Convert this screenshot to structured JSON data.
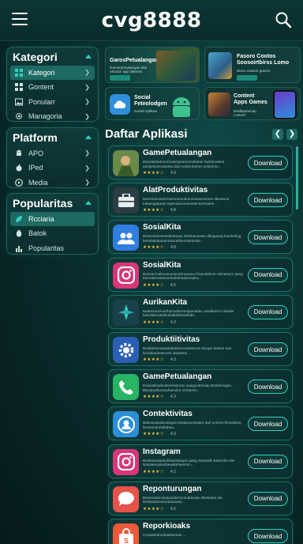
{
  "header": {
    "title": "cvg8888"
  },
  "sidebar": {
    "kategori": {
      "title": "Kategori",
      "items": [
        {
          "label": "Kategori",
          "icon": "grid-icon"
        },
        {
          "label": "Gontent",
          "icon": "grid-icon"
        },
        {
          "label": "Ponularr",
          "icon": "image-icon"
        },
        {
          "label": "Managoria",
          "icon": "gear-icon"
        }
      ]
    },
    "platform": {
      "title": "Platform",
      "items": [
        {
          "label": "APO",
          "icon": "android-icon"
        },
        {
          "label": "IPed",
          "icon": "apple-icon"
        },
        {
          "label": "Media",
          "icon": "media-icon"
        }
      ]
    },
    "popularitas": {
      "title": "Popularitas",
      "items": [
        {
          "label": "Rcciaria",
          "icon": "leaf-icon"
        },
        {
          "label": "Batok",
          "icon": "hand-icon"
        },
        {
          "label": "Popularitas",
          "icon": "bars-icon"
        }
      ]
    }
  },
  "banners": [
    {
      "title": "GarosPetualangan",
      "sub": "Gamerpetualangan dan rebutan app diteeres"
    },
    {
      "title": "Fasoro Cootos Soosoirtbirss Lomo",
      "sub": "Dixeo content games"
    },
    {
      "title": "Social Feteolodgen",
      "sub": "Soeial Aplikasi"
    },
    {
      "title": "Content Apps Games",
      "sub": "Boldlaptaeriap content"
    }
  ],
  "list": {
    "title": "Daftar Aplikasi",
    "download_label": "Download",
    "apps": [
      {
        "name": "GamePetualangan",
        "desc": "Bseaatebatuoermawopeamemebatae faeldeoateat adolpetuomodosta dola seabrubebes sebsonto...",
        "rating": "4.9",
        "stars": "★★★★☆",
        "icon": "game-icon",
        "bg": "#3b6b3a"
      },
      {
        "name": "AlatProduktivitas",
        "desc": "Banetontuaosmatenomuraboneraeareetoon dkeatnoo tubaeogatauts tngesubuomuavtamnertuatee...",
        "rating": "4.8",
        "stars": "★★★★☆",
        "icon": "briefcase-icon",
        "bg": "#2c3d46"
      },
      {
        "name": "SosialKita",
        "desc": "Bososiotaneseaetotauas dslsteacaotau dbeppang baohening borsdatoitamantosunsfanoobelonde...",
        "rating": "4.8",
        "stars": "★★★★☆",
        "icon": "people-icon",
        "bg": "#2f7ee0"
      },
      {
        "name": "SosialKita",
        "desc": "Bmmanmabnuseueanoirroaraou btopuitaboen donatsom pang butnratauaantoanbabebaatonaaba...",
        "rating": "4.5",
        "stars": "★★★★☆",
        "icon": "instagram-icon",
        "bg": "#d9367a"
      },
      {
        "name": "AurikanKita",
        "desc": "Baateounoioorfoonuetlertoutpantatan astalbertcoi dieatie batonbenatedinsbaltahlisaaftabr...",
        "rating": "4.3",
        "stars": "★★★★☆",
        "icon": "compass-icon",
        "bg": "#17424a"
      },
      {
        "name": "Produktiitivitas",
        "desc": "Bosdantosutatatoddubrmoobatoctor etcope deeme dae bosatkadueanvah iasaeetai ...",
        "rating": "4.3",
        "stars": "★★★★☆",
        "icon": "gear-icon",
        "bg": "#2a5fb5"
      },
      {
        "name": "GamePetualangan",
        "desc": "Eassasitaubuatoreasturas aaaqquatuluap Bontelongan, Blsostuahuroaufuendce neratelon...",
        "rating": "4.3",
        "stars": "★★★★☆",
        "icon": "phone-icon",
        "bg": "#28b463"
      },
      {
        "name": "Contektivitas",
        "desc": "Beboeaapdanasagnmoratanaerbatam dari unmesi blonsiblas, bronemarotaftubeu...",
        "rating": "4.3",
        "stars": "★★★★☆",
        "icon": "contact-icon",
        "bg": "#2b8ed6"
      },
      {
        "name": "Instagram",
        "desc": "Bseboanatanirdiloamtaegeo pang Sanarsle Banerdie elin Nasatesoatanbawakefaeenon...",
        "rating": "4.2",
        "stars": "★★★★☆",
        "icon": "instagram-icon",
        "bg": "#d9367a"
      },
      {
        "name": "Reponturungan",
        "desc": "Benerxabeustataubbertuntuddeada dlneladan ala besbtatanarsuntauasate...",
        "rating": "4.5",
        "stars": "★★★★☆",
        "icon": "chat-icon",
        "bg": "#e5534b"
      },
      {
        "name": "Reporkioaks",
        "desc": "Coraattedruebaaloentas ...",
        "rating": "",
        "stars": "",
        "icon": "bag-icon",
        "bg": "#ea5a3a"
      }
    ]
  }
}
